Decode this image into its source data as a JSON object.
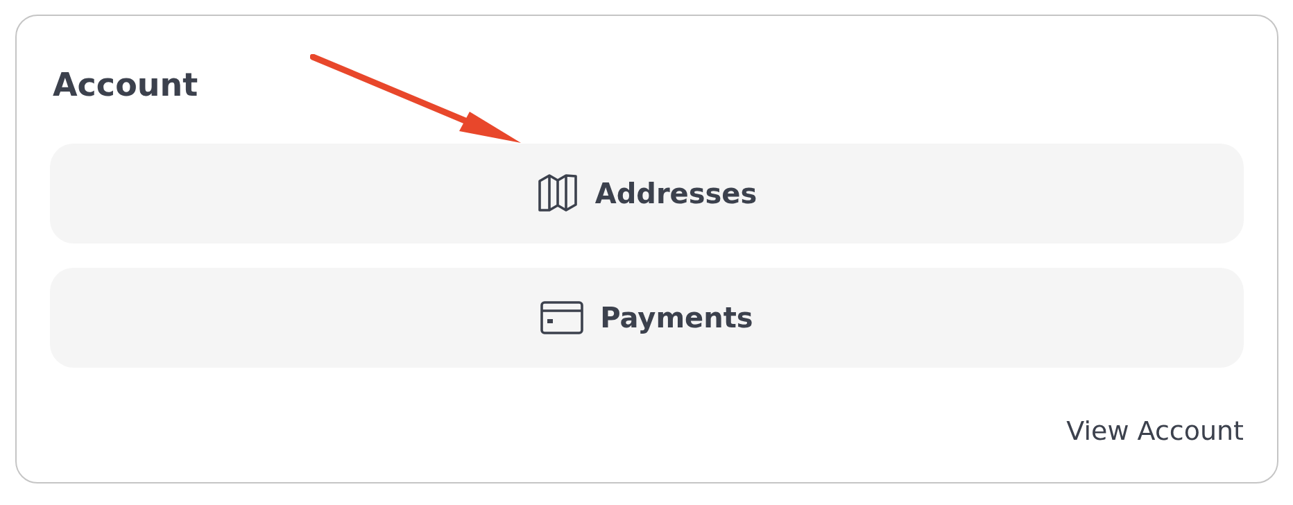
{
  "card": {
    "title": "Account",
    "buttons": [
      {
        "label": "Addresses"
      },
      {
        "label": "Payments"
      }
    ],
    "link": "View Account"
  }
}
